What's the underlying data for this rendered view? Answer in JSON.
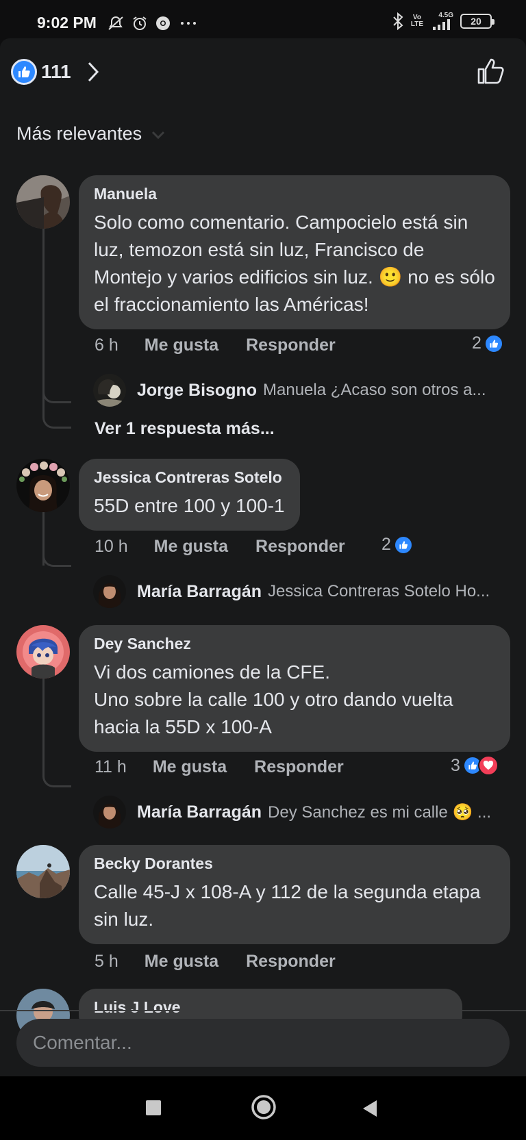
{
  "status_bar": {
    "time": "9:02 PM",
    "icons": [
      "mute-alarm-icon",
      "alarm-icon",
      "chrome-icon",
      "more-dots-icon",
      "bluetooth-icon",
      "volte-icon",
      "signal-icon"
    ],
    "volte_top": "Vo",
    "volte_bottom": "LTE",
    "network": "4.5G",
    "battery": "20"
  },
  "header": {
    "reaction_count": "111",
    "icons": [
      "like-reaction-icon",
      "chevron-right-icon",
      "like-outline-icon"
    ]
  },
  "sort": {
    "label": "Más relevantes",
    "icon": "chevron-down-icon"
  },
  "comments": [
    {
      "name": "Manuela",
      "text": "Solo como comentario. Campocielo está sin luz, temozon está sin luz, Francisco de Montejo y varios edificios sin luz. 🙂 no es sólo el fraccionamiento las Américas!",
      "time": "6 h",
      "like_label": "Me gusta",
      "reply_label": "Responder",
      "reaction_count": "2",
      "reply": {
        "name": "Jorge Bisogno",
        "text": "Manuela ¿Acaso son otros a..."
      },
      "more_replies": "Ver 1 respuesta más..."
    },
    {
      "name": "Jessica Contreras Sotelo",
      "text": "55D entre 100 y 100-1",
      "time": "10 h",
      "like_label": "Me gusta",
      "reply_label": "Responder",
      "reaction_count": "2",
      "reply": {
        "name": "María Barragán",
        "text": "Jessica Contreras Sotelo Ho..."
      }
    },
    {
      "name": "Dey Sanchez",
      "text": "Vi dos camiones de la CFE.\nUno sobre la calle 100 y otro dando vuelta hacia la 55D x 100-A",
      "time": "11 h",
      "like_label": "Me gusta",
      "reply_label": "Responder",
      "reaction_count": "3",
      "reply": {
        "name": "María Barragán",
        "text": "Dey Sanchez es mi calle 🥺 ..."
      }
    },
    {
      "name": "Becky Dorantes",
      "text": "Calle 45-J x 108-A y 112 de la segunda etapa sin luz.",
      "time": "5 h",
      "like_label": "Me gusta",
      "reply_label": "Responder"
    },
    {
      "name": "Luis J Love"
    }
  ],
  "composer": {
    "placeholder": "Comentar..."
  },
  "nav": {
    "icons": [
      "recents-square-icon",
      "home-circle-icon",
      "back-triangle-icon"
    ]
  },
  "colors": {
    "background": "#18191a",
    "bubble": "#3a3b3c",
    "like_blue": "#2d88ff",
    "heart_red": "#f33e58",
    "text_primary": "#e4e6eb",
    "text_secondary": "#b0b3b8"
  }
}
